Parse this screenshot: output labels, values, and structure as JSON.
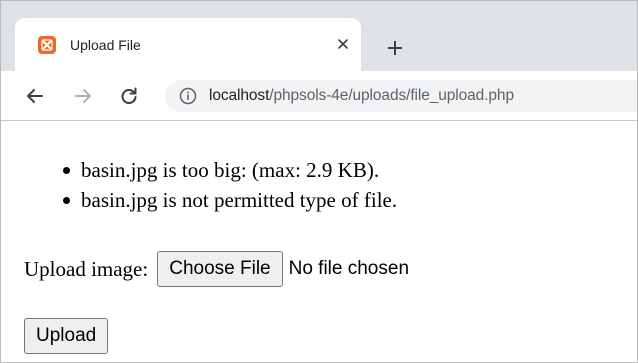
{
  "tab": {
    "title": "Upload File",
    "favicon": "xampp-icon",
    "close_glyph": "×",
    "new_tab_glyph": "+"
  },
  "toolbar": {
    "url_host": "localhost",
    "url_path": "/phpsols-4e/uploads/file_upload.php"
  },
  "page": {
    "errors": [
      "basin.jpg is too big: (max: 2.9 KB).",
      "basin.jpg is not permitted type of file."
    ],
    "upload_label": "Upload image:",
    "choose_file_label": "Choose File",
    "file_status": "No file chosen",
    "upload_button_label": "Upload"
  },
  "colors": {
    "tabstrip_bg": "#dee1e6",
    "omnibox_bg": "#f1f3f4",
    "favicon": "#f06a25"
  }
}
